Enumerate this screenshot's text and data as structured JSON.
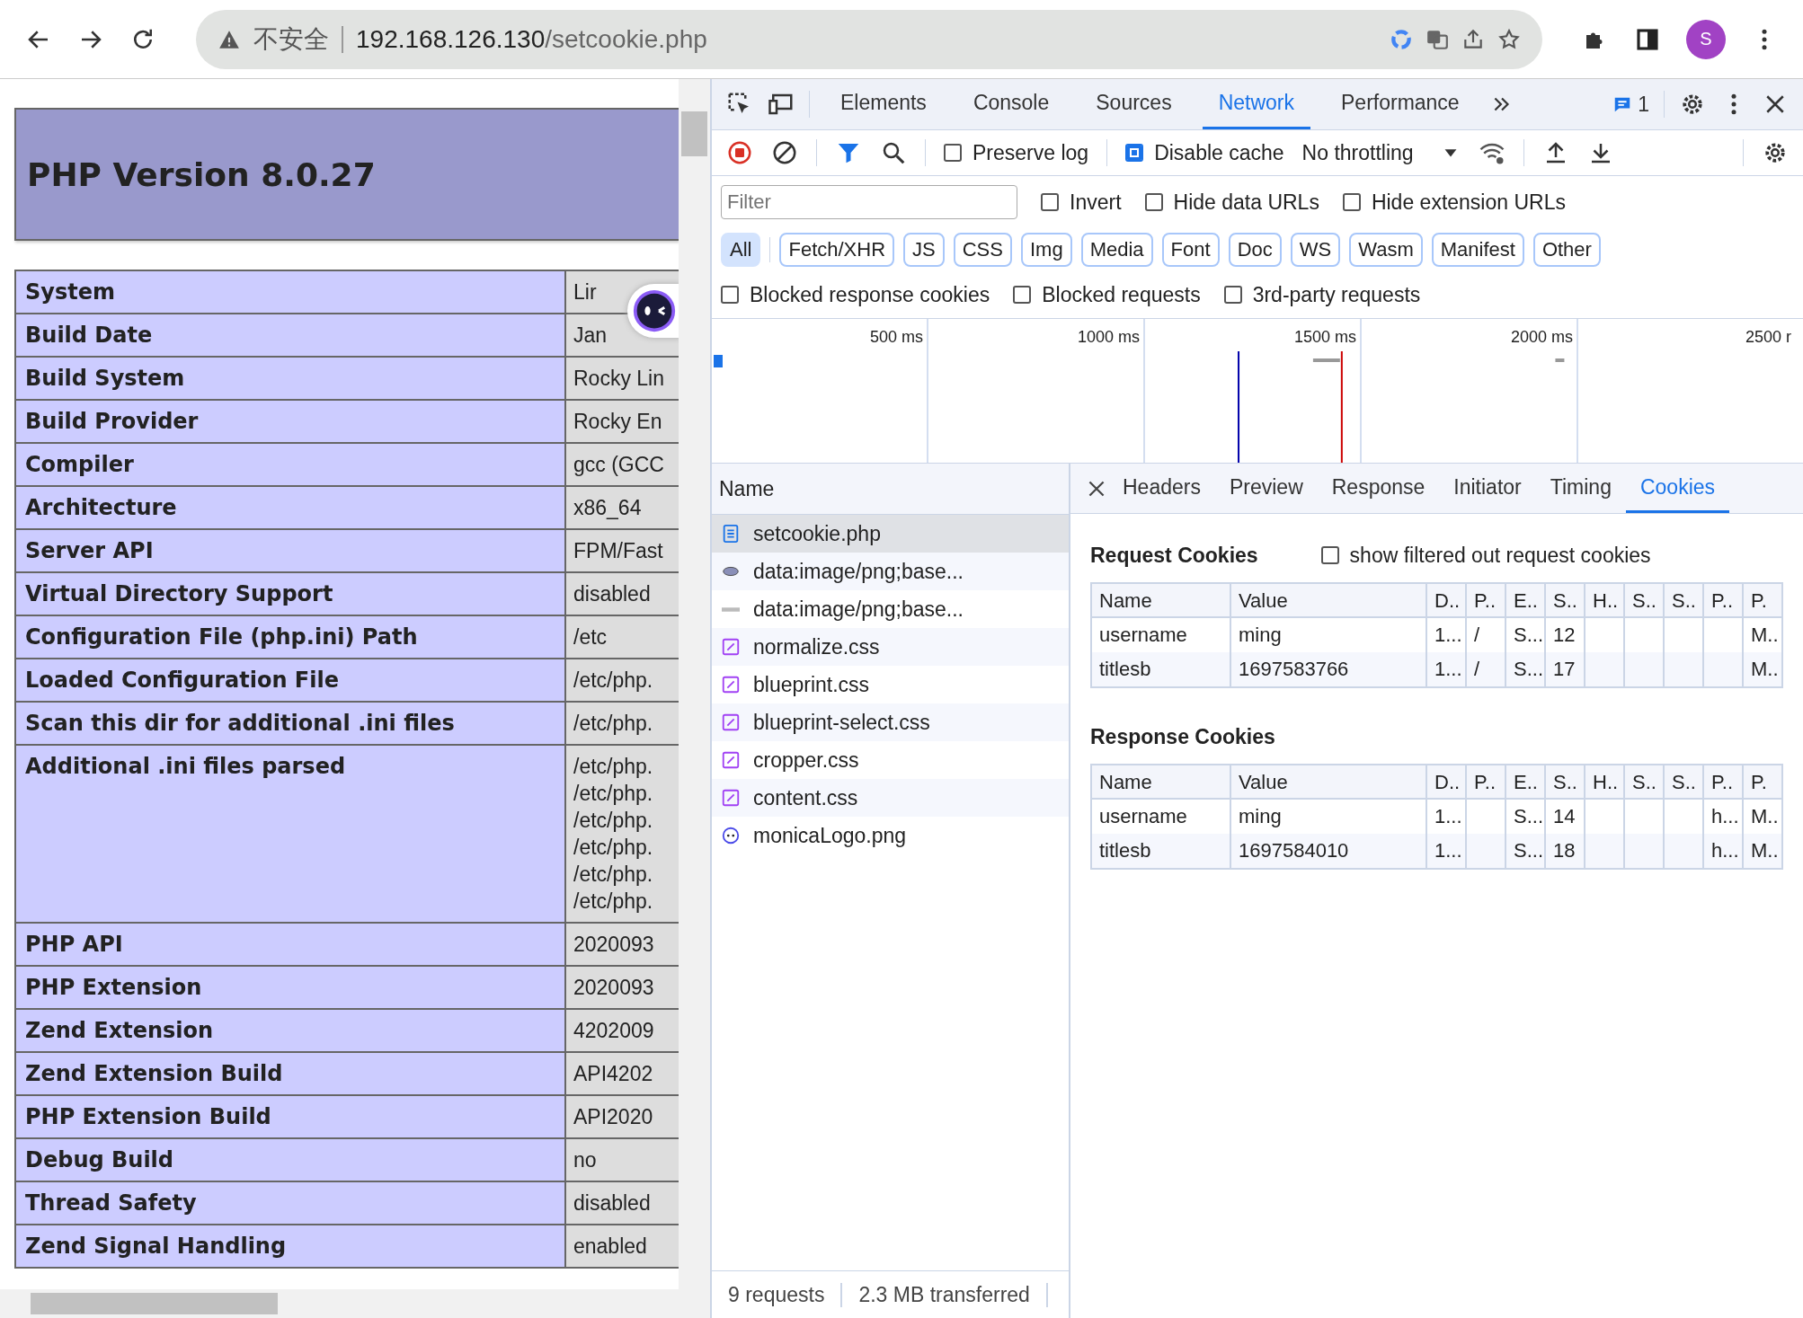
{
  "browser": {
    "security_label": "不安全",
    "url_host": "192.168.126.130",
    "url_path": "/setcookie.php",
    "avatar_letter": "S"
  },
  "php_page": {
    "title": "PHP Version 8.0.27",
    "rows": [
      {
        "key": "System",
        "values": [
          "Lir"
        ]
      },
      {
        "key": "Build Date",
        "values": [
          "Jan"
        ]
      },
      {
        "key": "Build System",
        "values": [
          "Rocky Lin"
        ]
      },
      {
        "key": "Build Provider",
        "values": [
          "Rocky En"
        ]
      },
      {
        "key": "Compiler",
        "values": [
          "gcc (GCC"
        ]
      },
      {
        "key": "Architecture",
        "values": [
          "x86_64"
        ]
      },
      {
        "key": "Server API",
        "values": [
          "FPM/Fast"
        ]
      },
      {
        "key": "Virtual Directory Support",
        "values": [
          "disabled"
        ]
      },
      {
        "key": "Configuration File (php.ini) Path",
        "values": [
          "/etc"
        ]
      },
      {
        "key": "Loaded Configuration File",
        "values": [
          "/etc/php."
        ]
      },
      {
        "key": "Scan this dir for additional .ini files",
        "values": [
          "/etc/php."
        ]
      },
      {
        "key": "Additional .ini files parsed",
        "values": [
          "/etc/php.",
          "/etc/php.",
          "/etc/php.",
          "/etc/php.",
          "/etc/php.",
          "/etc/php."
        ]
      },
      {
        "key": "PHP API",
        "values": [
          "2020093"
        ]
      },
      {
        "key": "PHP Extension",
        "values": [
          "2020093"
        ]
      },
      {
        "key": "Zend Extension",
        "values": [
          "4202009"
        ]
      },
      {
        "key": "Zend Extension Build",
        "values": [
          "API4202"
        ]
      },
      {
        "key": "PHP Extension Build",
        "values": [
          "API2020"
        ]
      },
      {
        "key": "Debug Build",
        "values": [
          "no"
        ]
      },
      {
        "key": "Thread Safety",
        "values": [
          "disabled"
        ]
      },
      {
        "key": "Zend Signal Handling",
        "values": [
          "enabled"
        ]
      }
    ]
  },
  "devtools": {
    "tabs": [
      {
        "label": "Elements",
        "selected": false
      },
      {
        "label": "Console",
        "selected": false
      },
      {
        "label": "Sources",
        "selected": false
      },
      {
        "label": "Network",
        "selected": true
      },
      {
        "label": "Performance",
        "selected": false
      }
    ],
    "issues_count": "1",
    "toolbar": {
      "recording": true,
      "filter_active": true,
      "preserve_log": {
        "label": "Preserve log",
        "checked": false
      },
      "disable_cache": {
        "label": "Disable cache",
        "checked": true
      },
      "throttling": "No throttling"
    },
    "filter": {
      "placeholder": "Filter",
      "options": [
        {
          "label": "Invert",
          "checked": false
        },
        {
          "label": "Hide data URLs",
          "checked": false
        },
        {
          "label": "Hide extension URLs",
          "checked": false
        }
      ]
    },
    "type_filters": [
      {
        "label": "All",
        "selected": true
      },
      {
        "label": "Fetch/XHR",
        "selected": false
      },
      {
        "label": "JS",
        "selected": false
      },
      {
        "label": "CSS",
        "selected": false
      },
      {
        "label": "Img",
        "selected": false
      },
      {
        "label": "Media",
        "selected": false
      },
      {
        "label": "Font",
        "selected": false
      },
      {
        "label": "Doc",
        "selected": false
      },
      {
        "label": "WS",
        "selected": false
      },
      {
        "label": "Wasm",
        "selected": false
      },
      {
        "label": "Manifest",
        "selected": false
      },
      {
        "label": "Other",
        "selected": false
      }
    ],
    "more_filters": [
      {
        "label": "Blocked response cookies",
        "checked": false
      },
      {
        "label": "Blocked requests",
        "checked": false
      },
      {
        "label": "3rd-party requests",
        "checked": false
      }
    ],
    "timeline_ticks": [
      "500 ms",
      "1000 ms",
      "1500 ms",
      "2000 ms",
      "2500 r"
    ],
    "requests_header": "Name",
    "requests": [
      {
        "name": "setcookie.php",
        "kind": "document",
        "selected": true
      },
      {
        "name": "data:image/png;base...",
        "kind": "image",
        "selected": false
      },
      {
        "name": "data:image/png;base...",
        "kind": "image-strip",
        "selected": false
      },
      {
        "name": "normalize.css",
        "kind": "stylesheet",
        "selected": false
      },
      {
        "name": "blueprint.css",
        "kind": "stylesheet",
        "selected": false
      },
      {
        "name": "blueprint-select.css",
        "kind": "stylesheet",
        "selected": false
      },
      {
        "name": "cropper.css",
        "kind": "stylesheet",
        "selected": false
      },
      {
        "name": "content.css",
        "kind": "stylesheet",
        "selected": false
      },
      {
        "name": "monicaLogo.png",
        "kind": "logo",
        "selected": false
      }
    ],
    "detail_tabs": [
      {
        "label": "Headers",
        "selected": false
      },
      {
        "label": "Preview",
        "selected": false
      },
      {
        "label": "Response",
        "selected": false
      },
      {
        "label": "Initiator",
        "selected": false
      },
      {
        "label": "Timing",
        "selected": false
      },
      {
        "label": "Cookies",
        "selected": true
      }
    ],
    "cookie_sections": [
      {
        "title": "Request Cookies",
        "option": {
          "label": "show filtered out request cookies",
          "checked": false
        },
        "columns": [
          "Name",
          "Value",
          "D..",
          "P..",
          "E..",
          "S..",
          "H..",
          "S..",
          "S..",
          "P..",
          "P."
        ],
        "rows": [
          [
            "username",
            "ming",
            "1...",
            "/",
            "S...",
            "12",
            null,
            null,
            null,
            null,
            "M.."
          ],
          [
            "titlesb",
            "1697583766",
            "1...",
            "/",
            "S...",
            "17",
            null,
            null,
            null,
            null,
            "M.."
          ]
        ]
      },
      {
        "title": "Response Cookies",
        "columns": [
          "Name",
          "Value",
          "D..",
          "P..",
          "E..",
          "S..",
          "H..",
          "S..",
          "S..",
          "P..",
          "P."
        ],
        "rows": [
          [
            "username",
            "ming",
            "1...",
            null,
            "S...",
            "14",
            null,
            null,
            null,
            "h...",
            "M.."
          ],
          [
            "titlesb",
            "1697584010",
            "1...",
            null,
            "S...",
            "18",
            null,
            null,
            null,
            "h...",
            "M.."
          ]
        ]
      }
    ],
    "status": [
      "9 requests",
      "2.3 MB transferred"
    ]
  }
}
